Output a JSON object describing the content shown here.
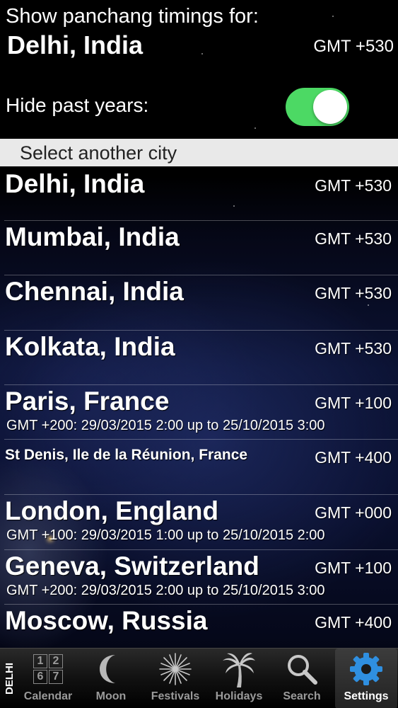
{
  "header": {
    "label": "Show panchang timings for:",
    "city": "Delhi, India",
    "gmt": "GMT +530"
  },
  "hide_past_years": {
    "label": "Hide past years:",
    "enabled": true,
    "accent": "#4cd964"
  },
  "section": {
    "title": "Select another city"
  },
  "cities": [
    {
      "name": "Delhi, India",
      "gmt": "GMT +530"
    },
    {
      "name": "Mumbai, India",
      "gmt": "GMT +530"
    },
    {
      "name": "Chennai, India",
      "gmt": "GMT +530"
    },
    {
      "name": "Kolkata, India",
      "gmt": "GMT +530"
    },
    {
      "name": "Paris, France",
      "gmt": "GMT +100",
      "dst": "GMT +200: 29/03/2015 2:00 up to 25/10/2015 3:00"
    },
    {
      "name": "St Denis, Ile de la Réunion, France",
      "gmt": "GMT +400"
    },
    {
      "name": "London, England",
      "gmt": "GMT +000",
      "dst": "GMT +100: 29/03/2015 1:00 up to 25/10/2015 2:00"
    },
    {
      "name": "Geneva, Switzerland",
      "gmt": "GMT +100",
      "dst": "GMT +200: 29/03/2015 2:00 up to 25/10/2015 3:00"
    },
    {
      "name": "Moscow, Russia",
      "gmt": "GMT +400"
    }
  ],
  "tabbar": {
    "city_tag": "DELHI",
    "calendar_digits": [
      "1",
      "2",
      "6",
      "7"
    ],
    "tabs": [
      {
        "label": "Calendar",
        "icon": "calendar-icon"
      },
      {
        "label": "Moon",
        "icon": "moon-icon"
      },
      {
        "label": "Festivals",
        "icon": "fireworks-icon"
      },
      {
        "label": "Holidays",
        "icon": "palm-tree-icon"
      },
      {
        "label": "Search",
        "icon": "search-icon"
      },
      {
        "label": "Settings",
        "icon": "gear-icon",
        "active": true
      }
    ]
  }
}
